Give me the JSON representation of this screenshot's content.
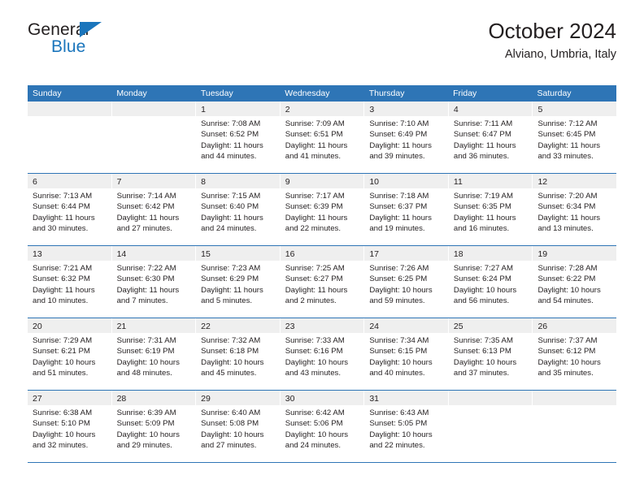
{
  "brand": {
    "name_part1": "General",
    "name_part2": "Blue",
    "accent_color": "#1a75bc"
  },
  "header": {
    "title": "October 2024",
    "subtitle": "Alviano, Umbria, Italy"
  },
  "theme": {
    "header_row_color": "#2e75b6",
    "day_band_color": "#efefef",
    "text_color": "#231f20"
  },
  "weekdays": [
    "Sunday",
    "Monday",
    "Tuesday",
    "Wednesday",
    "Thursday",
    "Friday",
    "Saturday"
  ],
  "weeks": [
    [
      {
        "num": "",
        "lines": []
      },
      {
        "num": "",
        "lines": []
      },
      {
        "num": "1",
        "lines": [
          "Sunrise: 7:08 AM",
          "Sunset: 6:52 PM",
          "Daylight: 11 hours",
          "and 44 minutes."
        ]
      },
      {
        "num": "2",
        "lines": [
          "Sunrise: 7:09 AM",
          "Sunset: 6:51 PM",
          "Daylight: 11 hours",
          "and 41 minutes."
        ]
      },
      {
        "num": "3",
        "lines": [
          "Sunrise: 7:10 AM",
          "Sunset: 6:49 PM",
          "Daylight: 11 hours",
          "and 39 minutes."
        ]
      },
      {
        "num": "4",
        "lines": [
          "Sunrise: 7:11 AM",
          "Sunset: 6:47 PM",
          "Daylight: 11 hours",
          "and 36 minutes."
        ]
      },
      {
        "num": "5",
        "lines": [
          "Sunrise: 7:12 AM",
          "Sunset: 6:45 PM",
          "Daylight: 11 hours",
          "and 33 minutes."
        ]
      }
    ],
    [
      {
        "num": "6",
        "lines": [
          "Sunrise: 7:13 AM",
          "Sunset: 6:44 PM",
          "Daylight: 11 hours",
          "and 30 minutes."
        ]
      },
      {
        "num": "7",
        "lines": [
          "Sunrise: 7:14 AM",
          "Sunset: 6:42 PM",
          "Daylight: 11 hours",
          "and 27 minutes."
        ]
      },
      {
        "num": "8",
        "lines": [
          "Sunrise: 7:15 AM",
          "Sunset: 6:40 PM",
          "Daylight: 11 hours",
          "and 24 minutes."
        ]
      },
      {
        "num": "9",
        "lines": [
          "Sunrise: 7:17 AM",
          "Sunset: 6:39 PM",
          "Daylight: 11 hours",
          "and 22 minutes."
        ]
      },
      {
        "num": "10",
        "lines": [
          "Sunrise: 7:18 AM",
          "Sunset: 6:37 PM",
          "Daylight: 11 hours",
          "and 19 minutes."
        ]
      },
      {
        "num": "11",
        "lines": [
          "Sunrise: 7:19 AM",
          "Sunset: 6:35 PM",
          "Daylight: 11 hours",
          "and 16 minutes."
        ]
      },
      {
        "num": "12",
        "lines": [
          "Sunrise: 7:20 AM",
          "Sunset: 6:34 PM",
          "Daylight: 11 hours",
          "and 13 minutes."
        ]
      }
    ],
    [
      {
        "num": "13",
        "lines": [
          "Sunrise: 7:21 AM",
          "Sunset: 6:32 PM",
          "Daylight: 11 hours",
          "and 10 minutes."
        ]
      },
      {
        "num": "14",
        "lines": [
          "Sunrise: 7:22 AM",
          "Sunset: 6:30 PM",
          "Daylight: 11 hours",
          "and 7 minutes."
        ]
      },
      {
        "num": "15",
        "lines": [
          "Sunrise: 7:23 AM",
          "Sunset: 6:29 PM",
          "Daylight: 11 hours",
          "and 5 minutes."
        ]
      },
      {
        "num": "16",
        "lines": [
          "Sunrise: 7:25 AM",
          "Sunset: 6:27 PM",
          "Daylight: 11 hours",
          "and 2 minutes."
        ]
      },
      {
        "num": "17",
        "lines": [
          "Sunrise: 7:26 AM",
          "Sunset: 6:25 PM",
          "Daylight: 10 hours",
          "and 59 minutes."
        ]
      },
      {
        "num": "18",
        "lines": [
          "Sunrise: 7:27 AM",
          "Sunset: 6:24 PM",
          "Daylight: 10 hours",
          "and 56 minutes."
        ]
      },
      {
        "num": "19",
        "lines": [
          "Sunrise: 7:28 AM",
          "Sunset: 6:22 PM",
          "Daylight: 10 hours",
          "and 54 minutes."
        ]
      }
    ],
    [
      {
        "num": "20",
        "lines": [
          "Sunrise: 7:29 AM",
          "Sunset: 6:21 PM",
          "Daylight: 10 hours",
          "and 51 minutes."
        ]
      },
      {
        "num": "21",
        "lines": [
          "Sunrise: 7:31 AM",
          "Sunset: 6:19 PM",
          "Daylight: 10 hours",
          "and 48 minutes."
        ]
      },
      {
        "num": "22",
        "lines": [
          "Sunrise: 7:32 AM",
          "Sunset: 6:18 PM",
          "Daylight: 10 hours",
          "and 45 minutes."
        ]
      },
      {
        "num": "23",
        "lines": [
          "Sunrise: 7:33 AM",
          "Sunset: 6:16 PM",
          "Daylight: 10 hours",
          "and 43 minutes."
        ]
      },
      {
        "num": "24",
        "lines": [
          "Sunrise: 7:34 AM",
          "Sunset: 6:15 PM",
          "Daylight: 10 hours",
          "and 40 minutes."
        ]
      },
      {
        "num": "25",
        "lines": [
          "Sunrise: 7:35 AM",
          "Sunset: 6:13 PM",
          "Daylight: 10 hours",
          "and 37 minutes."
        ]
      },
      {
        "num": "26",
        "lines": [
          "Sunrise: 7:37 AM",
          "Sunset: 6:12 PM",
          "Daylight: 10 hours",
          "and 35 minutes."
        ]
      }
    ],
    [
      {
        "num": "27",
        "lines": [
          "Sunrise: 6:38 AM",
          "Sunset: 5:10 PM",
          "Daylight: 10 hours",
          "and 32 minutes."
        ]
      },
      {
        "num": "28",
        "lines": [
          "Sunrise: 6:39 AM",
          "Sunset: 5:09 PM",
          "Daylight: 10 hours",
          "and 29 minutes."
        ]
      },
      {
        "num": "29",
        "lines": [
          "Sunrise: 6:40 AM",
          "Sunset: 5:08 PM",
          "Daylight: 10 hours",
          "and 27 minutes."
        ]
      },
      {
        "num": "30",
        "lines": [
          "Sunrise: 6:42 AM",
          "Sunset: 5:06 PM",
          "Daylight: 10 hours",
          "and 24 minutes."
        ]
      },
      {
        "num": "31",
        "lines": [
          "Sunrise: 6:43 AM",
          "Sunset: 5:05 PM",
          "Daylight: 10 hours",
          "and 22 minutes."
        ]
      },
      {
        "num": "",
        "lines": []
      },
      {
        "num": "",
        "lines": []
      }
    ]
  ]
}
